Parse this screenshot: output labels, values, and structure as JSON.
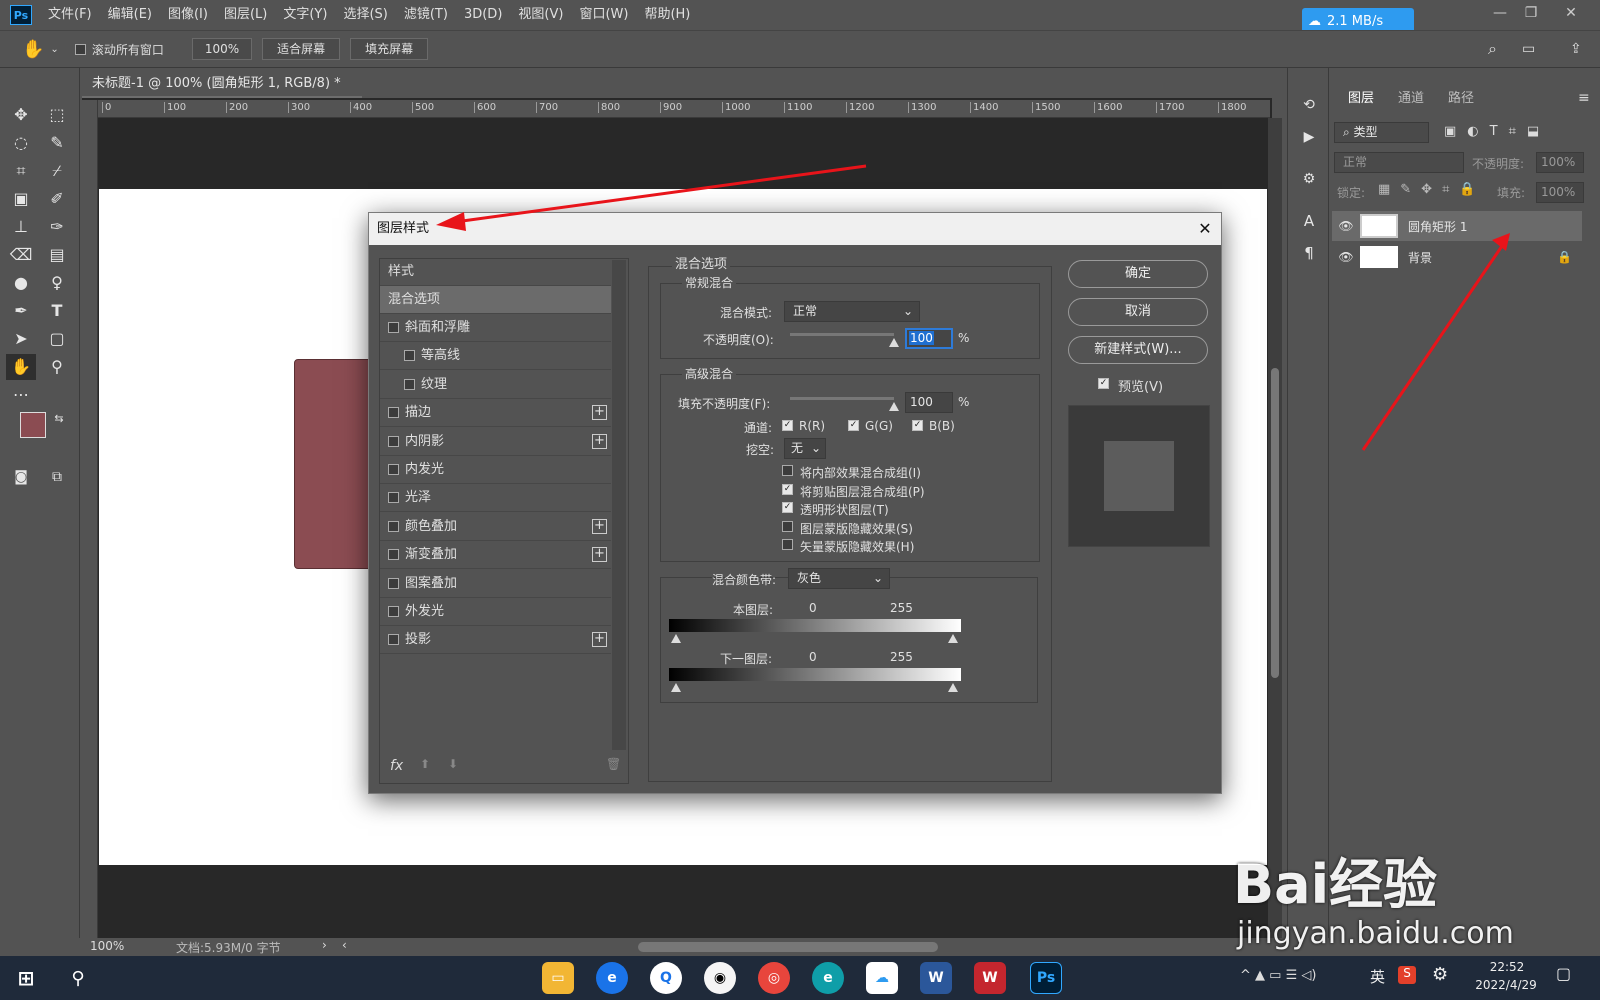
{
  "app": {
    "logo": "Ps"
  },
  "menu": [
    "文件(F)",
    "编辑(E)",
    "图像(I)",
    "图层(L)",
    "文字(Y)",
    "选择(S)",
    "滤镜(T)",
    "3D(D)",
    "视图(V)",
    "窗口(W)",
    "帮助(H)"
  ],
  "speed_badge": "2.1 MB/s",
  "options": {
    "scroll_all": "滚动所有窗口",
    "zoom": "100%",
    "fit_screen": "适合屏幕",
    "fill_screen": "填充屏幕"
  },
  "document": {
    "tab_title": "未标题-1 @ 100% (圆角矩形 1, RGB/8) *",
    "zoom": "100%",
    "doc_info": "文档:5.93M/0 字节"
  },
  "ruler_h": [
    "0",
    "100",
    "200",
    "300",
    "400",
    "500",
    "600",
    "700",
    "800",
    "900",
    "1000",
    "1100",
    "1200",
    "1300",
    "1400",
    "1500",
    "1600",
    "1700",
    "1800"
  ],
  "panels": {
    "tabs": [
      "图层",
      "通道",
      "路径"
    ],
    "filter": "类型",
    "blend": "正常",
    "opacity_label": "不透明度:",
    "opacity": "100%",
    "lock_label": "锁定:",
    "fill_label": "填充:",
    "fill": "100%"
  },
  "layers": [
    {
      "name": "圆角矩形 1"
    },
    {
      "name": "背景"
    }
  ],
  "dialog": {
    "title": "图层样式",
    "styles_header": "样式",
    "blend_options": "混合选项",
    "styles": [
      {
        "label": "斜面和浮雕",
        "indent": false,
        "plus": false
      },
      {
        "label": "等高线",
        "indent": true,
        "plus": false
      },
      {
        "label": "纹理",
        "indent": true,
        "plus": false
      },
      {
        "label": "描边",
        "indent": false,
        "plus": true
      },
      {
        "label": "内阴影",
        "indent": false,
        "plus": true
      },
      {
        "label": "内发光",
        "indent": false,
        "plus": false
      },
      {
        "label": "光泽",
        "indent": false,
        "plus": false
      },
      {
        "label": "颜色叠加",
        "indent": false,
        "plus": true
      },
      {
        "label": "渐变叠加",
        "indent": false,
        "plus": true
      },
      {
        "label": "图案叠加",
        "indent": false,
        "plus": false
      },
      {
        "label": "外发光",
        "indent": false,
        "plus": false
      },
      {
        "label": "投影",
        "indent": false,
        "plus": true
      }
    ],
    "fx": "fx",
    "section_title": "混合选项",
    "general": "常规混合",
    "blend_mode_label": "混合模式:",
    "blend_mode": "正常",
    "opacity_label": "不透明度(O):",
    "opacity": "100",
    "opacity_level": 1.0,
    "percent": "%",
    "advanced": "高级混合",
    "fill_label": "填充不透明度(F):",
    "fill": "100",
    "fill_level": 1.0,
    "channels_label": "通道:",
    "channels": [
      "R(R)",
      "G(G)",
      "B(B)"
    ],
    "knockout_label": "挖空:",
    "knockout": "无",
    "options": [
      {
        "label": "将内部效果混合成组(I)",
        "checked": false
      },
      {
        "label": "将剪贴图层混合成组(P)",
        "checked": true
      },
      {
        "label": "透明形状图层(T)",
        "checked": true
      },
      {
        "label": "图层蒙版隐藏效果(S)",
        "checked": false
      },
      {
        "label": "矢量蒙版隐藏效果(H)",
        "checked": false
      }
    ],
    "blend_if_label": "混合颜色带:",
    "blend_if": "灰色",
    "this_layer": "本图层:",
    "underlying": "下一图层:",
    "range_min": "0",
    "range_max": "255",
    "ok": "确定",
    "cancel": "取消",
    "new_style": "新建样式(W)...",
    "preview": "预览(V)"
  },
  "taskbar": {
    "time": "22:52",
    "date": "2022/4/29",
    "ime": "英"
  },
  "watermark": {
    "brand": "Bai经验",
    "url": "jingyan.baidu.com"
  },
  "colors": {
    "ui_bg": "#535353",
    "canvas": "#ffffff",
    "rect_fill": "#8b4c52",
    "arrow": "#e8141a",
    "accent": "#2e9bf0"
  }
}
